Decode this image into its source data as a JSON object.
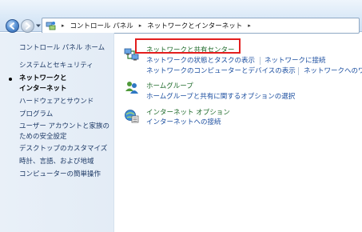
{
  "breadcrumb": {
    "items": [
      "コントロール パネル",
      "ネットワークとインターネット"
    ]
  },
  "sidebar": {
    "home": "コントロール パネル ホーム",
    "items": [
      {
        "label": "システムとセキュリティ"
      },
      {
        "label": "ネットワークと",
        "label2": "インターネット",
        "current": true
      },
      {
        "label": "ハードウェアとサウンド"
      },
      {
        "label": "プログラム"
      },
      {
        "label": "ユーザー アカウントと家族の",
        "label2": "ための安全設定"
      },
      {
        "label": "デスクトップのカスタマイズ"
      },
      {
        "label": "時計、言語、および地域"
      },
      {
        "label": "コンピューターの簡単操作"
      }
    ]
  },
  "categories": [
    {
      "title": "ネットワークと共有センター",
      "icon": "network-sharing-center-icon",
      "links_row1": [
        "ネットワークの状態とタスクの表示",
        "ネットワークに接続"
      ],
      "links_row2": [
        "ネットワークのコンピューターとデバイスの表示",
        "ネットワークへのワ"
      ]
    },
    {
      "title": "ホームグループ",
      "icon": "homegroup-icon",
      "links_row1": [
        "ホームグループと共有に関するオプションの選択"
      ]
    },
    {
      "title": "インターネット オプション",
      "icon": "internet-options-icon",
      "links_row1": [
        "インターネットへの接続"
      ]
    }
  ],
  "colors": {
    "category_title": "#1f6b2b",
    "task_link": "#1c4fa0",
    "highlight": "#e31e1e"
  }
}
